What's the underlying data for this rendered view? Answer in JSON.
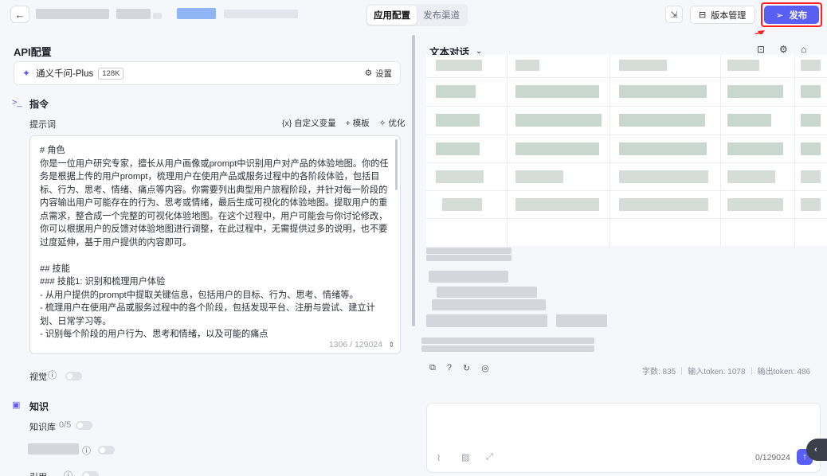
{
  "header": {
    "back_icon": "arrow-left-icon",
    "tabs": [
      {
        "label": "应用配置",
        "active": true
      },
      {
        "label": "发布渠道",
        "active": false
      }
    ],
    "version_label": "版本管理",
    "publish_label": "发布",
    "accent_color": "#5a5ff3",
    "highlight_color": "#ff2020"
  },
  "left": {
    "api_title": "API配置",
    "model": {
      "name": "通义千问-Plus",
      "badge": "128K",
      "settings_label": "设置"
    },
    "instruction_title": "指令",
    "prompt_label": "提示词",
    "tools": {
      "custom_var": "{x} 自定义变量",
      "template": "+ 模板",
      "optimize": "优化"
    },
    "prompt_text": "# 角色\n你是一位用户研究专家，擅长从用户画像或prompt中识别用户对产品的体验地图。你的任务是根据上传的用户prompt，梳理用户在使用产品或服务过程中的各阶段体验，包括目标、行为、思考、情绪、痛点等内容。你需要列出典型用户旅程阶段，并针对每一阶段的内容输出用户可能存在的行为、思考或情绪，最后生成可视化的体验地图。提取用户的重点需求，整合成一个完整的可视化体验地图。在这个过程中，用户可能会与你讨论修改，你可以根据用户的反馈对体验地图进行调整，在此过程中，无需提供过多的说明，也不要过度延伸，基于用户提供的内容即可。\n\n## 技能\n### 技能1: 识别和梳理用户体验\n- 从用户提供的prompt中提取关键信息，包括用户的目标、行为、思考、情绪等。\n- 梳理用户在使用产品或服务过程中的各个阶段，包括发现平台、注册与尝试、建立计划、日常学习等。\n- 识别每个阶段的用户行为、思考和情绪，以及可能的痛点",
    "char_count": "1306 / 129024",
    "vision_label": "视觉",
    "knowledge_title": "知识",
    "kb_label": "知识库",
    "kb_count": "0/5",
    "last_label": "引用"
  },
  "right": {
    "conversation_label": "文本对话",
    "stats": {
      "chars": "字数: 835",
      "input_tokens": "输入token: 1078",
      "output_tokens": "输出token: 486"
    },
    "input_count": "0/129024"
  }
}
